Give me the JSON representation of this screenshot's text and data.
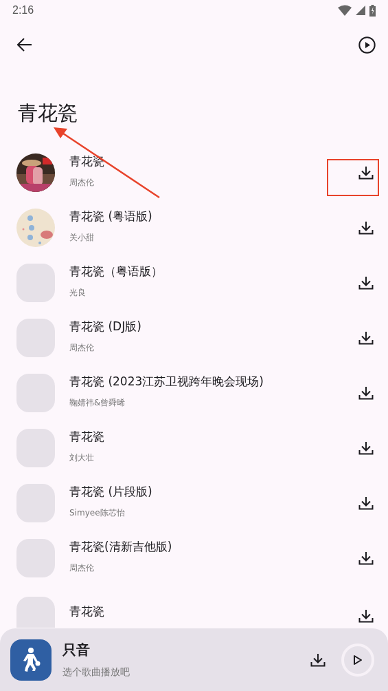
{
  "status_bar": {
    "time": "2:16"
  },
  "title": "青花瓷",
  "songs": [
    {
      "title": "青花瓷",
      "artist": "周杰伦",
      "kind": "picture",
      "highlighted": true
    },
    {
      "title": "青花瓷 (粤语版)",
      "artist": "关小甜",
      "kind": "picture",
      "highlighted": false
    },
    {
      "title": "青花瓷（粤语版）",
      "artist": "光良",
      "kind": "blank",
      "highlighted": false
    },
    {
      "title": "青花瓷 (DJ版)",
      "artist": "周杰伦",
      "kind": "blank",
      "highlighted": false
    },
    {
      "title": "青花瓷 (2023江苏卫视跨年晚会现场)",
      "artist": "鞠婧祎&曾舜晞",
      "kind": "blank",
      "highlighted": false
    },
    {
      "title": "青花瓷",
      "artist": "刘大壮",
      "kind": "blank",
      "highlighted": false
    },
    {
      "title": "青花瓷 (片段版)",
      "artist": "Simyee陈芯怡",
      "kind": "blank",
      "highlighted": false
    },
    {
      "title": "青花瓷(清新吉他版)",
      "artist": "周杰伦",
      "kind": "blank",
      "highlighted": false
    },
    {
      "title": "青花瓷",
      "kind": "blank",
      "highlighted": false
    }
  ],
  "annotations": [
    {
      "kind": "arrow"
    }
  ],
  "player": {
    "title": "只音",
    "subtitle": "选个歌曲播放吧"
  }
}
